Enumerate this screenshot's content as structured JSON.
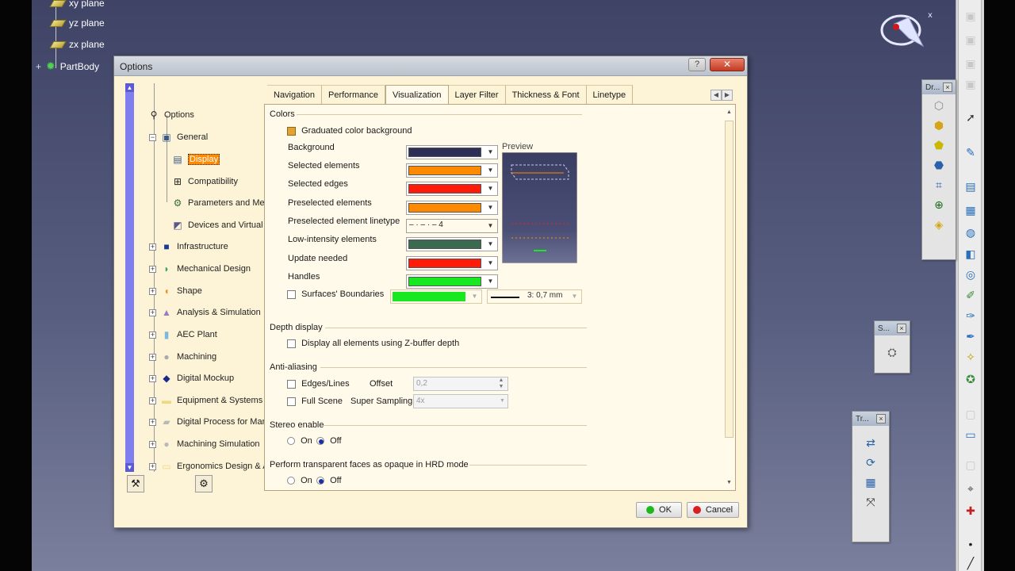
{
  "background_tree": {
    "items": [
      "xy plane",
      "yz plane",
      "zx plane",
      "PartBody"
    ]
  },
  "dialog": {
    "title": "Options",
    "help_label": "?",
    "close_label": "✕",
    "ok_label": "OK",
    "cancel_label": "Cancel"
  },
  "tree": {
    "root": "Options",
    "general": "General",
    "general_children": [
      "Display",
      "Compatibility",
      "Parameters and Mea",
      "Devices and Virtual"
    ],
    "categories": [
      "Infrastructure",
      "Mechanical Design",
      "Shape",
      "Analysis & Simulation",
      "AEC Plant",
      "Machining",
      "Digital Mockup",
      "Equipment & Systems",
      "Digital Process for Mar",
      "Machining Simulation",
      "Ergonomics Design & A"
    ]
  },
  "tabs": [
    "Navigation",
    "Performance",
    "Visualization",
    "Layer Filter",
    "Thickness & Font",
    "Linetype"
  ],
  "active_tab": "Visualization",
  "colors_section": {
    "title": "Colors",
    "graduated_label": "Graduated color background",
    "preview_label": "Preview",
    "rows": [
      {
        "label": "Background",
        "color": "#2c2e58"
      },
      {
        "label": "Selected elements",
        "color": "#ff8a00"
      },
      {
        "label": "Selected edges",
        "color": "#ff1a0a"
      },
      {
        "label": "Preselected elements",
        "color": "#ff8a00"
      },
      {
        "label": "Preselected element linetype",
        "linetype": "– · – · –   4"
      },
      {
        "label": "Low-intensity elements",
        "color": "#3a6a50"
      },
      {
        "label": "Update needed",
        "color": "#ff1a0a"
      },
      {
        "label": "Handles",
        "color": "#18e820"
      }
    ],
    "surfaces_label": "Surfaces' Boundaries",
    "surfaces_color": "#18e820",
    "surfaces_thickness": "3: 0,7 mm"
  },
  "depth": {
    "title": "Depth display",
    "zbuffer_label": "Display all elements using Z-buffer depth"
  },
  "antialias": {
    "title": "Anti-aliasing",
    "edges_label": "Edges/Lines",
    "offset_label": "Offset",
    "offset_value": "0,2",
    "fullscene_label": "Full Scene",
    "supersampling_label": "Super Sampling",
    "supersampling_value": "4x"
  },
  "stereo": {
    "title": "Stereo enable",
    "on_label": "On",
    "off_label": "Off"
  },
  "transparent": {
    "title": "Perform transparent faces as opaque in HRD mode",
    "on_label": "On",
    "off_label": "Off"
  },
  "mini_toolbars": {
    "dr": "Dr...",
    "s": "S...",
    "tr": "Tr...",
    "close": "×"
  }
}
